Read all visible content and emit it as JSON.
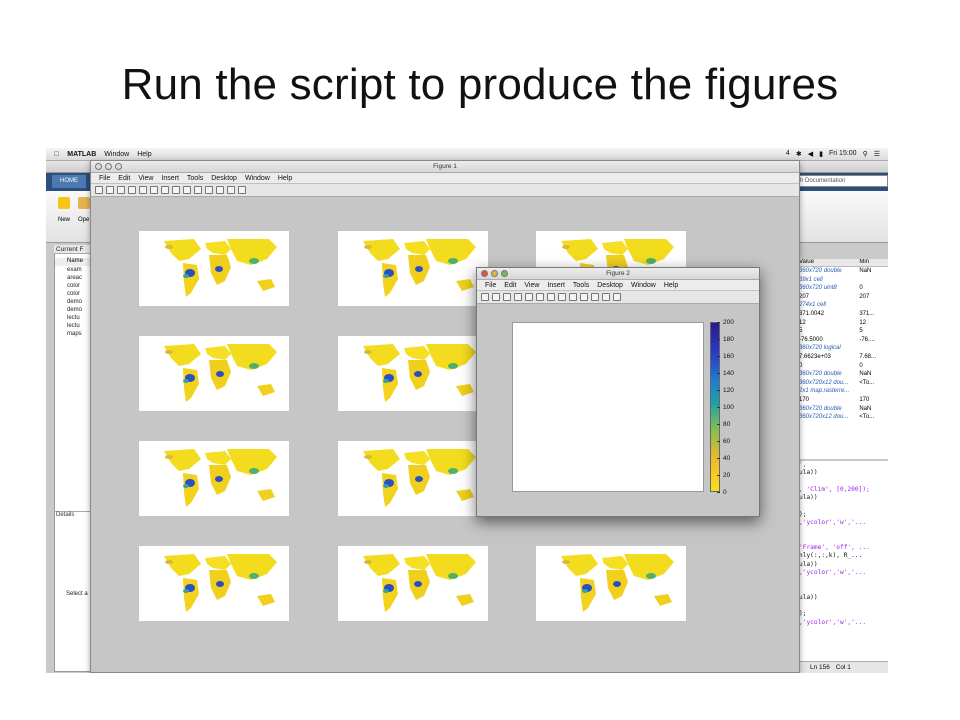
{
  "slide": {
    "title": "Run the script to produce the figures"
  },
  "macbar": {
    "app": "MATLAB",
    "menus": [
      "Window",
      "Help"
    ],
    "status_right": [
      "4",
      "Fri 15:00"
    ]
  },
  "matlab": {
    "home_tab": "HOME",
    "search_placeholder": "ch Documentation",
    "ribbon_new": "New",
    "ribbon_open": "Ope",
    "current_folder_label": "Current F",
    "folder_header": "Name",
    "files": [
      "exam",
      "areac",
      "color",
      "color",
      "demo",
      "demo",
      "lectu",
      "lectu",
      "maps"
    ],
    "details_label": "Details",
    "select_label": "Select a",
    "workspace": {
      "headers": [
        "Value",
        "Min"
      ],
      "rows": [
        [
          "360x720 double",
          "NaN"
        ],
        [
          "39x1 cell",
          ""
        ],
        [
          "360x720 uint8",
          "0"
        ],
        [
          "207",
          "207"
        ],
        [
          "274x1 cell",
          ""
        ],
        [
          "371.0042",
          "371..."
        ],
        [
          "12",
          "12"
        ],
        [
          "5",
          "5"
        ],
        [
          "-76.5000",
          "-76...."
        ],
        [
          "360x720 logical",
          ""
        ],
        [
          "7.6623e+03",
          "7.68..."
        ],
        [
          "0",
          "0"
        ],
        [
          "360x720 double",
          "NaN"
        ],
        [
          "360x720x12 dou...",
          "<To..."
        ],
        [
          "2x1 map.rasterre...",
          ""
        ],
        [
          "170",
          "170"
        ],
        [
          "360x720 double",
          "NaN"
        ],
        [
          "360x720x12 dou...",
          "<To..."
        ]
      ]
    },
    "editor_lines": [
      "',",
      "ula))",
      "",
      ", 'Clim', [0,200]);",
      "ula))",
      "",
      ");",
      ",'ycolor','w','...",
      "",
      "",
      "'Frame', 'off', ...",
      "nly(:,:,k), R_...",
      "ula))",
      ",'ycolor','w','...",
      "",
      "",
      "ula))",
      "",
      ");",
      ",'ycolor','w','..."
    ],
    "status": {
      "ln_label": "Ln",
      "ln": "156",
      "col_label": "Col",
      "col": "1"
    }
  },
  "figure1": {
    "title": "Figure 1",
    "menus": [
      "File",
      "Edit",
      "View",
      "Insert",
      "Tools",
      "Desktop",
      "Window",
      "Help"
    ]
  },
  "figure2": {
    "title": "Figure 2",
    "menus": [
      "File",
      "Edit",
      "View",
      "Insert",
      "Tools",
      "Desktop",
      "Window",
      "Help"
    ],
    "colorbar_ticks": [
      "200",
      "180",
      "160",
      "140",
      "120",
      "100",
      "80",
      "60",
      "40",
      "20",
      "0"
    ]
  },
  "colors": {
    "ribbon_blue": "#2b4f7e",
    "map_yellow": "#f3dc1e",
    "map_blue": "#2a4fc2"
  }
}
